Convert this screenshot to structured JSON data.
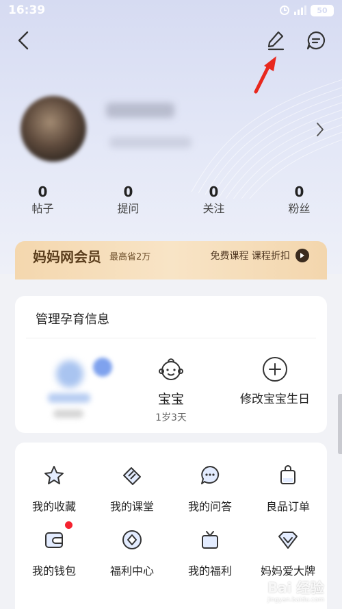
{
  "status_bar": {
    "time": "16:39",
    "battery": "50"
  },
  "stats": [
    {
      "count": "0",
      "label": "帖子"
    },
    {
      "count": "0",
      "label": "提问"
    },
    {
      "count": "0",
      "label": "关注"
    },
    {
      "count": "0",
      "label": "粉丝"
    }
  ],
  "vip": {
    "title": "妈妈网会员",
    "subtitle": "最高省2万",
    "promo": "免费课程 课程折扣"
  },
  "baby_section": {
    "title": "管理孕育信息",
    "baby_name": "宝宝",
    "baby_age": "1岁3天",
    "edit_birthday": "修改宝宝生日"
  },
  "menu": [
    {
      "label": "我的收藏",
      "icon": "star-icon"
    },
    {
      "label": "我的课堂",
      "icon": "classroom-icon"
    },
    {
      "label": "我的问答",
      "icon": "qa-icon"
    },
    {
      "label": "良品订单",
      "icon": "shopping-bag-icon"
    },
    {
      "label": "我的钱包",
      "icon": "wallet-icon"
    },
    {
      "label": "福利中心",
      "icon": "welfare-icon"
    },
    {
      "label": "我的福利",
      "icon": "gift-icon"
    },
    {
      "label": "妈妈爱大牌",
      "icon": "diamond-icon"
    }
  ],
  "watermark": {
    "brand": "Bai 经验",
    "url": "jingyan.baidu.com"
  },
  "colors": {
    "accent_red": "#f5232f",
    "vip_gold": "#f4d7ae",
    "header_bg": "#d6dbf2"
  }
}
